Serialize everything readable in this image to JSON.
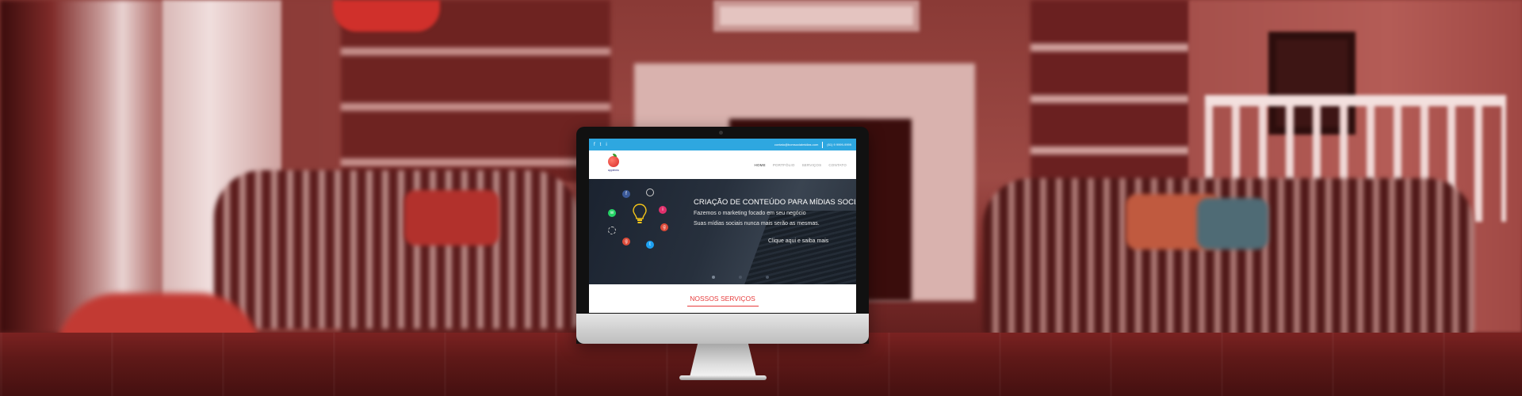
{
  "site": {
    "topbar": {
      "social": [
        "f",
        "t",
        "i"
      ],
      "email": "contato@bomsocialmidias.com",
      "phone": "(61) 9 9999-9999"
    },
    "logo": {
      "wordmark": "appleinto"
    },
    "menu": [
      {
        "label": "HOME",
        "active": true
      },
      {
        "label": "PORTFÓLIO"
      },
      {
        "label": "SERVIÇOS"
      },
      {
        "label": "CONTATO"
      }
    ],
    "hero": {
      "title": "CRIAÇÃO DE CONTEÚDO PARA MÍDIAS SOCIAIS",
      "line1": "Fazemos o marketing focado em seu negócio",
      "line2": "Suas mídias sociais nunca mais serão as mesmas.",
      "cta": "Clique aqui e saiba mais"
    },
    "services": {
      "title": "NOSSOS SERVIÇOS"
    }
  },
  "colors": {
    "topbar": "#2ea7e0",
    "accent": "#e73c3c",
    "hero": "#27303d"
  },
  "icons": [
    "facebook-icon",
    "twitter-icon",
    "instagram-icon",
    "whatsapp-icon",
    "lightbulb-icon",
    "gear-icon",
    "google-plus-icon"
  ]
}
